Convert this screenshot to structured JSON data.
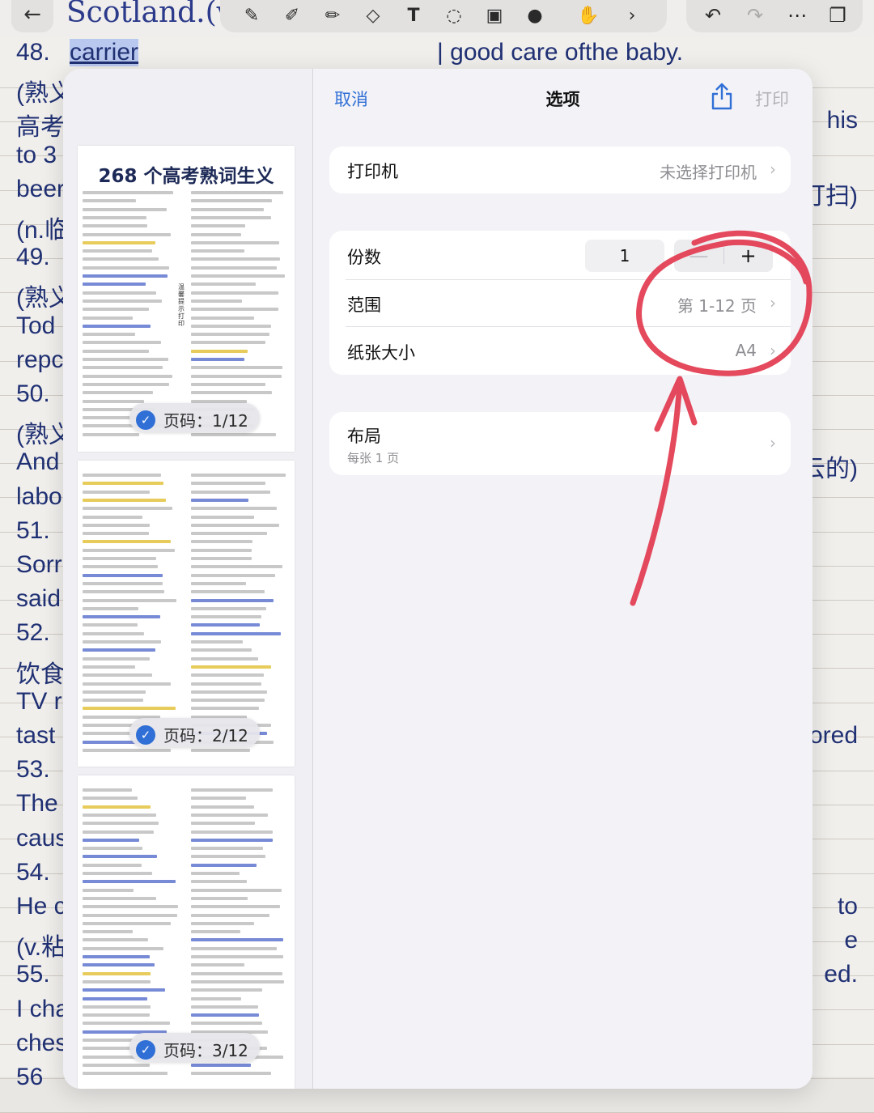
{
  "background": {
    "note_title": "Scotland.(v.陷",
    "lines": [
      {
        "left": "48.",
        "mid": "carrier",
        "right": "| good care ofthe baby."
      },
      {
        "left": "(熟义",
        "right": ""
      },
      {
        "left": "高考",
        "right": "his"
      },
      {
        "left": "to 3",
        "right": ""
      },
      {
        "left": "beer",
        "right": "打扫)"
      },
      {
        "left": "(n.临",
        "right": ""
      },
      {
        "left": "49.",
        "right": ""
      },
      {
        "left": "(熟义",
        "right": ""
      },
      {
        "left": "Tod",
        "right": ""
      },
      {
        "left": "repc",
        "right": ""
      },
      {
        "left": "50.",
        "right": ""
      },
      {
        "left": "(熟义",
        "right": ""
      },
      {
        "left": "And",
        "right": "云的)"
      },
      {
        "left": "labo",
        "right": ""
      },
      {
        "left": "51.",
        "right": ""
      },
      {
        "left": "Sorr",
        "right": ""
      },
      {
        "left": "said",
        "right": ""
      },
      {
        "left": "52.",
        "right": ""
      },
      {
        "left": "饮食",
        "right": ""
      },
      {
        "left": "TV r",
        "right": ""
      },
      {
        "left": "tast",
        "right": "ored"
      },
      {
        "left": "53.",
        "right": ""
      },
      {
        "left": "The",
        "right": ""
      },
      {
        "left": "caus",
        "right": ""
      },
      {
        "left": "54.",
        "right": ""
      },
      {
        "left": "He c",
        "right": "to"
      },
      {
        "left": "(v.粘",
        "right": "e"
      },
      {
        "left": "55.",
        "right": "ed."
      },
      {
        "left": "I cha",
        "right": ""
      },
      {
        "left": "ches",
        "right": ""
      },
      {
        "left": "56",
        "right": ""
      }
    ]
  },
  "nav": {
    "cancel": "取消",
    "title": "选项",
    "share_icon": "share-icon",
    "print": "打印"
  },
  "options": {
    "printer": {
      "label": "打印机",
      "value": "未选择打印机"
    },
    "copies": {
      "label": "份数",
      "value": "1",
      "minus": "—",
      "plus": "+"
    },
    "range": {
      "label": "范围",
      "value": "第 1-12 页"
    },
    "paper": {
      "label": "纸张大小",
      "value": "A4"
    },
    "layout": {
      "label": "布局",
      "sub": "每张 1 页"
    }
  },
  "pages": [
    {
      "title": "268 个高考熟词生义",
      "badge": "页码：1/12",
      "selected": true
    },
    {
      "title": "",
      "badge": "页码：2/12",
      "selected": true
    },
    {
      "title": "",
      "badge": "页码：3/12",
      "selected": true
    }
  ],
  "check_symbol": "✓",
  "page1_vertical": "温馨提示打印",
  "colors": {
    "accent": "#2f6fd6",
    "annotation": "#e23a4f"
  }
}
